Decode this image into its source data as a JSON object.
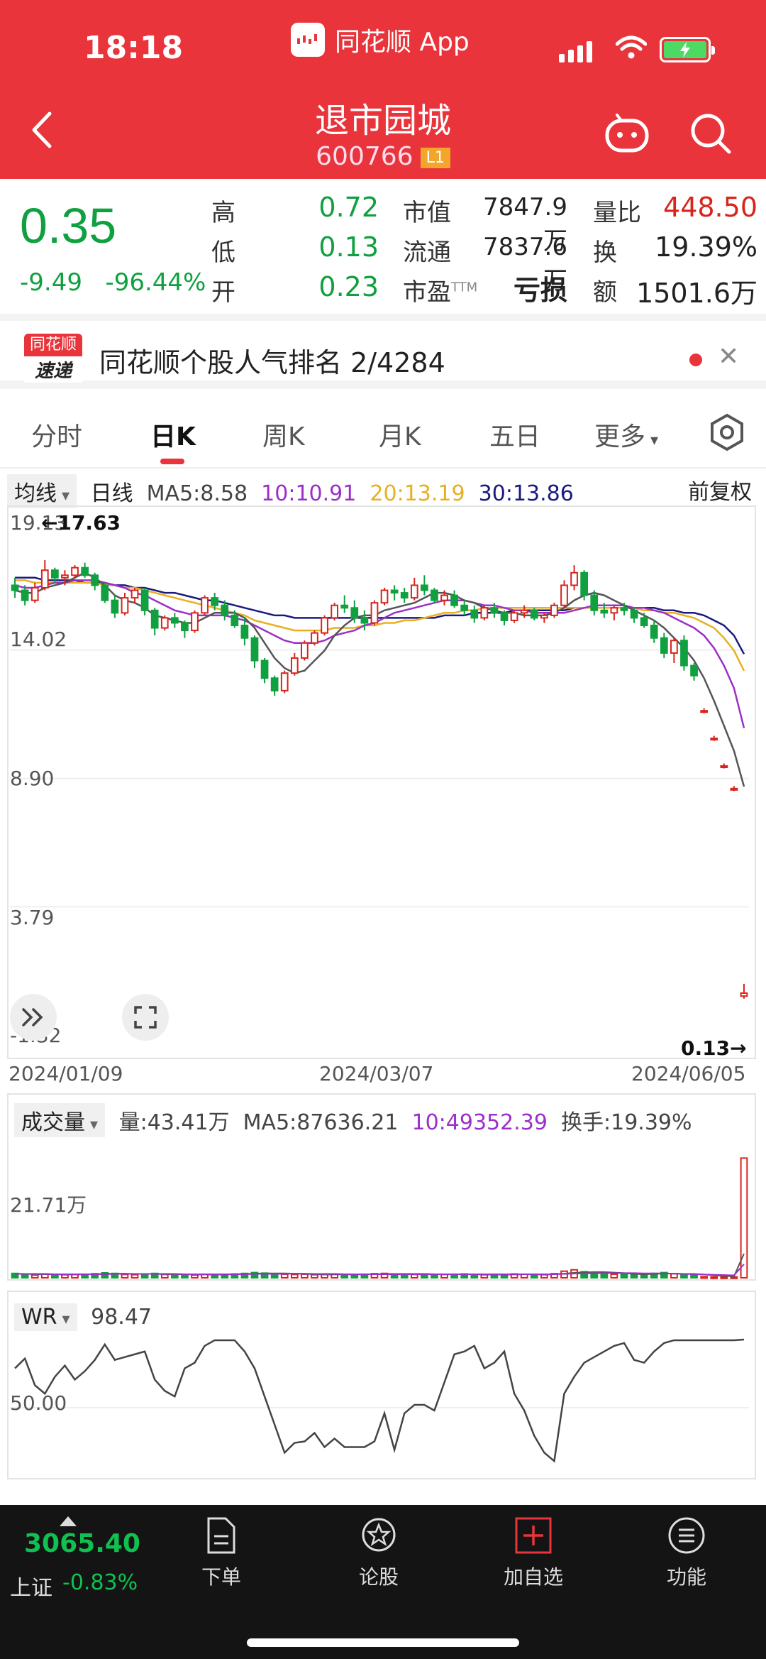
{
  "status": {
    "time": "18:18",
    "app_name": "同花顺 App"
  },
  "header": {
    "title": "退市园城",
    "code": "600766",
    "level_badge": "L1"
  },
  "quote": {
    "price": "0.35",
    "change": "-9.49",
    "change_pct": "-96.44%",
    "high_label": "高",
    "high": "0.72",
    "low_label": "低",
    "low": "0.13",
    "open_label": "开",
    "open": "0.23",
    "mcap_label": "市值",
    "mcap": "7847.9万",
    "float_label": "流通",
    "float": "7837.6万",
    "pe_label": "市盈",
    "pe_sup": "TTM",
    "pe": "亏损",
    "vr_label": "量比",
    "vr": "448.50",
    "turnover_label": "换",
    "turnover": "19.39%",
    "amount_label": "额",
    "amount": "1501.6万"
  },
  "popularity": {
    "logo_top": "同花顺",
    "logo_bottom": "速递",
    "text": "同花顺个股人气排名 2/4284"
  },
  "tabs": [
    "分时",
    "日K",
    "周K",
    "月K",
    "五日",
    "更多"
  ],
  "kline": {
    "ma_dropdown": "均线",
    "period": "日线",
    "ma5": "MA5:8.58",
    "ma10": "10:10.91",
    "ma20": "20:13.19",
    "ma30": "30:13.86",
    "adjust": "前复权",
    "yticks": [
      "19.13",
      "14.02",
      "8.90",
      "3.79",
      "-1.32"
    ],
    "max_label": "←17.63",
    "min_label": "0.13→",
    "dates": [
      "2024/01/09",
      "2024/03/07",
      "2024/06/05"
    ]
  },
  "volume": {
    "dropdown": "成交量",
    "vol": "量:43.41万",
    "ma5": "MA5:87636.21",
    "ma10": "10:49352.39",
    "turnover": "换手:19.39%",
    "ytick": "21.71万"
  },
  "wr": {
    "dropdown": "WR",
    "value": "98.47",
    "ytick": "50.00"
  },
  "bottom": {
    "index_value": "3065.40",
    "index_name": "上证",
    "index_change": "-0.83%",
    "nav": [
      "下单",
      "论股",
      "加自选",
      "功能"
    ]
  },
  "colors": {
    "up": "#d8241c",
    "down": "#10a040",
    "ma5": "#555555",
    "ma10": "#9b30c8",
    "ma20": "#e8b020",
    "ma30": "#1a1a80",
    "brand": "#e8343a"
  },
  "chart_data": [
    {
      "type": "candlestick",
      "title": "日线",
      "x_range": [
        "2024/01/09",
        "2024/06/05"
      ],
      "ylim": [
        -1.32,
        19.13
      ],
      "ohlc": [
        [
          16.6,
          16.9,
          16.1,
          16.4
        ],
        [
          16.4,
          16.6,
          15.8,
          16.0
        ],
        [
          16.0,
          16.7,
          15.9,
          16.5
        ],
        [
          16.5,
          17.6,
          16.4,
          17.2
        ],
        [
          17.2,
          17.3,
          16.7,
          16.9
        ],
        [
          16.9,
          17.2,
          16.6,
          17.0
        ],
        [
          17.0,
          17.4,
          16.9,
          17.3
        ],
        [
          17.3,
          17.5,
          16.9,
          17.0
        ],
        [
          17.0,
          17.1,
          16.4,
          16.6
        ],
        [
          16.6,
          16.7,
          15.9,
          16.0
        ],
        [
          16.0,
          16.2,
          15.3,
          15.5
        ],
        [
          15.5,
          16.3,
          15.4,
          16.1
        ],
        [
          16.1,
          16.5,
          15.9,
          16.4
        ],
        [
          16.4,
          16.5,
          15.4,
          15.6
        ],
        [
          15.6,
          15.7,
          14.6,
          14.9
        ],
        [
          14.9,
          15.4,
          14.8,
          15.3
        ],
        [
          15.3,
          15.5,
          14.9,
          15.1
        ],
        [
          15.1,
          15.2,
          14.5,
          14.8
        ],
        [
          14.8,
          15.6,
          14.7,
          15.5
        ],
        [
          15.5,
          16.2,
          15.4,
          16.1
        ],
        [
          16.1,
          16.3,
          15.6,
          15.8
        ],
        [
          15.8,
          16.0,
          15.2,
          15.4
        ],
        [
          15.4,
          15.6,
          14.9,
          15.0
        ],
        [
          15.0,
          15.3,
          14.2,
          14.5
        ],
        [
          14.5,
          14.6,
          13.3,
          13.6
        ],
        [
          13.6,
          13.7,
          12.7,
          12.9
        ],
        [
          12.9,
          13.0,
          12.2,
          12.4
        ],
        [
          12.4,
          13.2,
          12.3,
          13.1
        ],
        [
          13.1,
          13.9,
          13.0,
          13.7
        ],
        [
          13.7,
          14.4,
          13.6,
          14.3
        ],
        [
          14.3,
          14.8,
          14.2,
          14.7
        ],
        [
          14.7,
          15.4,
          14.6,
          15.3
        ],
        [
          15.3,
          15.9,
          15.2,
          15.8
        ],
        [
          15.8,
          16.2,
          15.5,
          15.7
        ],
        [
          15.7,
          16.0,
          15.1,
          15.3
        ],
        [
          15.3,
          15.6,
          14.8,
          15.1
        ],
        [
          15.1,
          16.0,
          15.0,
          15.9
        ],
        [
          15.9,
          16.5,
          15.8,
          16.4
        ],
        [
          16.4,
          16.6,
          16.0,
          16.3
        ],
        [
          16.3,
          16.5,
          15.9,
          16.1
        ],
        [
          16.1,
          16.9,
          16.0,
          16.6
        ],
        [
          16.6,
          17.0,
          16.2,
          16.4
        ],
        [
          16.4,
          16.5,
          15.9,
          16.0
        ],
        [
          16.0,
          16.4,
          15.8,
          16.2
        ],
        [
          16.2,
          16.4,
          15.7,
          15.8
        ],
        [
          15.8,
          16.0,
          15.4,
          15.6
        ],
        [
          15.6,
          15.8,
          15.1,
          15.3
        ],
        [
          15.3,
          15.8,
          15.2,
          15.7
        ],
        [
          15.7,
          15.9,
          15.3,
          15.5
        ],
        [
          15.5,
          15.6,
          15.0,
          15.2
        ],
        [
          15.2,
          15.6,
          15.1,
          15.5
        ],
        [
          15.5,
          15.8,
          15.3,
          15.6
        ],
        [
          15.6,
          15.7,
          15.2,
          15.3
        ],
        [
          15.3,
          15.5,
          15.1,
          15.4
        ],
        [
          15.4,
          15.9,
          15.3,
          15.8
        ],
        [
          15.8,
          16.8,
          15.7,
          16.6
        ],
        [
          16.6,
          17.4,
          16.4,
          17.1
        ],
        [
          17.1,
          17.2,
          16.0,
          16.2
        ],
        [
          16.2,
          16.4,
          15.4,
          15.6
        ],
        [
          15.6,
          15.9,
          15.3,
          15.5
        ],
        [
          15.5,
          15.8,
          15.2,
          15.7
        ],
        [
          15.7,
          15.9,
          15.4,
          15.6
        ],
        [
          15.6,
          15.7,
          15.1,
          15.3
        ],
        [
          15.3,
          15.5,
          14.9,
          15.0
        ],
        [
          15.0,
          15.2,
          14.3,
          14.5
        ],
        [
          14.5,
          14.7,
          13.7,
          13.9
        ],
        [
          13.9,
          14.5,
          13.5,
          14.4
        ],
        [
          14.4,
          14.6,
          13.2,
          13.4
        ],
        [
          13.4,
          13.5,
          12.8,
          13.0
        ],
        [
          11.6,
          11.7,
          11.5,
          11.6
        ],
        [
          10.5,
          10.6,
          10.4,
          10.5
        ],
        [
          9.4,
          9.5,
          9.3,
          9.4
        ],
        [
          8.5,
          8.6,
          8.4,
          8.5
        ],
        [
          0.23,
          0.72,
          0.13,
          0.35
        ]
      ],
      "ma5": [
        16.4,
        16.3,
        16.3,
        16.5,
        16.6,
        16.7,
        16.9,
        17.1,
        16.9,
        16.6,
        16.2,
        16.0,
        15.9,
        15.7,
        15.4,
        15.3,
        15.2,
        15.1,
        15.1,
        15.3,
        15.5,
        15.5,
        15.5,
        15.3,
        14.9,
        14.3,
        13.7,
        13.3,
        13.1,
        13.2,
        13.6,
        14.0,
        14.6,
        15.0,
        15.3,
        15.4,
        15.4,
        15.6,
        15.7,
        15.8,
        15.9,
        16.1,
        16.3,
        16.3,
        16.2,
        16.0,
        15.9,
        15.7,
        15.6,
        15.5,
        15.5,
        15.4,
        15.4,
        15.4,
        15.5,
        15.7,
        16.0,
        16.2,
        16.3,
        16.2,
        16.0,
        15.8,
        15.6,
        15.4,
        15.2,
        14.9,
        14.5,
        14.1,
        13.6,
        12.9,
        12.0,
        11.0,
        10.0,
        8.58
      ],
      "ma10": [
        16.6,
        16.5,
        16.5,
        16.6,
        16.7,
        16.7,
        16.8,
        16.8,
        16.8,
        16.7,
        16.6,
        16.5,
        16.3,
        16.2,
        16.0,
        15.8,
        15.6,
        15.5,
        15.4,
        15.4,
        15.4,
        15.4,
        15.3,
        15.2,
        15.0,
        14.8,
        14.6,
        14.4,
        14.3,
        14.3,
        14.3,
        14.4,
        14.6,
        14.7,
        14.8,
        15.0,
        15.1,
        15.3,
        15.5,
        15.6,
        15.7,
        15.8,
        15.9,
        16.0,
        16.0,
        16.0,
        15.9,
        15.8,
        15.8,
        15.7,
        15.6,
        15.6,
        15.5,
        15.5,
        15.5,
        15.5,
        15.6,
        15.7,
        15.8,
        15.8,
        15.8,
        15.8,
        15.7,
        15.7,
        15.6,
        15.5,
        15.3,
        15.1,
        14.9,
        14.6,
        14.1,
        13.4,
        12.5,
        10.91
      ],
      "ma20": [
        16.8,
        16.8,
        16.7,
        16.7,
        16.7,
        16.7,
        16.7,
        16.7,
        16.7,
        16.6,
        16.6,
        16.5,
        16.5,
        16.4,
        16.3,
        16.2,
        16.1,
        16.0,
        15.9,
        15.8,
        15.7,
        15.6,
        15.5,
        15.4,
        15.2,
        15.1,
        15.0,
        14.9,
        14.8,
        14.8,
        14.8,
        14.8,
        14.9,
        14.9,
        14.9,
        15.0,
        15.0,
        15.1,
        15.1,
        15.2,
        15.2,
        15.3,
        15.4,
        15.5,
        15.5,
        15.6,
        15.6,
        15.7,
        15.7,
        15.7,
        15.7,
        15.7,
        15.7,
        15.7,
        15.7,
        15.7,
        15.7,
        15.7,
        15.7,
        15.7,
        15.7,
        15.7,
        15.7,
        15.6,
        15.6,
        15.5,
        15.5,
        15.4,
        15.3,
        15.1,
        14.9,
        14.5,
        14.0,
        13.19
      ],
      "ma30": [
        16.9,
        16.9,
        16.9,
        16.8,
        16.8,
        16.8,
        16.8,
        16.7,
        16.7,
        16.7,
        16.6,
        16.6,
        16.5,
        16.5,
        16.4,
        16.3,
        16.3,
        16.2,
        16.1,
        16.0,
        16.0,
        15.9,
        15.8,
        15.7,
        15.6,
        15.5,
        15.4,
        15.4,
        15.3,
        15.3,
        15.3,
        15.3,
        15.3,
        15.3,
        15.3,
        15.3,
        15.3,
        15.3,
        15.3,
        15.3,
        15.3,
        15.3,
        15.3,
        15.4,
        15.4,
        15.4,
        15.5,
        15.5,
        15.5,
        15.5,
        15.6,
        15.6,
        15.6,
        15.6,
        15.6,
        15.6,
        15.7,
        15.7,
        15.7,
        15.7,
        15.7,
        15.7,
        15.7,
        15.7,
        15.7,
        15.6,
        15.6,
        15.5,
        15.5,
        15.4,
        15.2,
        15.0,
        14.6,
        13.86
      ]
    },
    {
      "type": "bar",
      "title": "成交量",
      "unit": "万",
      "ylim": [
        0,
        52
      ],
      "values": [
        1.6,
        1.2,
        1.0,
        1.4,
        1.3,
        1.1,
        1.2,
        1.3,
        1.5,
        1.8,
        1.6,
        1.2,
        1.1,
        1.3,
        1.6,
        1.2,
        1.1,
        1.2,
        1.0,
        1.3,
        1.2,
        1.3,
        1.4,
        1.6,
        1.9,
        1.7,
        1.5,
        1.3,
        1.2,
        1.3,
        1.1,
        1.2,
        1.4,
        1.3,
        1.2,
        1.3,
        1.5,
        1.6,
        1.4,
        1.3,
        1.2,
        1.4,
        1.3,
        1.2,
        1.3,
        1.4,
        1.2,
        1.1,
        1.3,
        1.2,
        1.4,
        1.3,
        1.2,
        1.1,
        1.5,
        2.4,
        2.9,
        2.2,
        1.6,
        1.4,
        1.3,
        1.2,
        1.3,
        1.4,
        1.6,
        1.9,
        1.5,
        1.3,
        1.1,
        0.4,
        0.3,
        0.3,
        0.3,
        43.41
      ],
      "ma5": [
        1.4,
        1.4,
        1.3,
        1.3,
        1.3,
        1.2,
        1.2,
        1.3,
        1.3,
        1.4,
        1.5,
        1.5,
        1.4,
        1.4,
        1.4,
        1.3,
        1.3,
        1.3,
        1.2,
        1.2,
        1.2,
        1.2,
        1.3,
        1.4,
        1.5,
        1.6,
        1.6,
        1.6,
        1.5,
        1.4,
        1.3,
        1.2,
        1.2,
        1.3,
        1.2,
        1.3,
        1.3,
        1.4,
        1.4,
        1.4,
        1.4,
        1.4,
        1.3,
        1.3,
        1.3,
        1.3,
        1.3,
        1.2,
        1.2,
        1.2,
        1.2,
        1.3,
        1.3,
        1.2,
        1.3,
        1.5,
        1.8,
        2.0,
        2.1,
        2.1,
        1.9,
        1.7,
        1.4,
        1.3,
        1.4,
        1.5,
        1.5,
        1.4,
        1.4,
        1.2,
        0.9,
        0.7,
        0.5,
        8.76
      ],
      "ma10": [
        1.5,
        1.4,
        1.4,
        1.4,
        1.3,
        1.3,
        1.3,
        1.3,
        1.3,
        1.3,
        1.4,
        1.4,
        1.4,
        1.4,
        1.4,
        1.4,
        1.4,
        1.3,
        1.3,
        1.3,
        1.3,
        1.3,
        1.3,
        1.3,
        1.4,
        1.4,
        1.4,
        1.4,
        1.5,
        1.5,
        1.4,
        1.4,
        1.4,
        1.3,
        1.3,
        1.3,
        1.3,
        1.3,
        1.3,
        1.3,
        1.3,
        1.3,
        1.3,
        1.3,
        1.3,
        1.3,
        1.3,
        1.3,
        1.3,
        1.3,
        1.3,
        1.3,
        1.3,
        1.3,
        1.3,
        1.4,
        1.5,
        1.6,
        1.6,
        1.7,
        1.7,
        1.7,
        1.7,
        1.6,
        1.6,
        1.6,
        1.5,
        1.4,
        1.3,
        1.2,
        1.1,
        1.0,
        0.9,
        4.94
      ]
    },
    {
      "type": "line",
      "title": "WR",
      "ylim": [
        0,
        100
      ],
      "values": [
        78,
        85,
        66,
        60,
        72,
        80,
        70,
        76,
        84,
        95,
        84,
        86,
        88,
        90,
        70,
        62,
        58,
        78,
        82,
        94,
        98,
        98,
        98,
        90,
        78,
        58,
        38,
        18,
        25,
        26,
        32,
        22,
        28,
        22,
        22,
        22,
        26,
        46,
        20,
        46,
        52,
        52,
        48,
        68,
        88,
        90,
        94,
        78,
        82,
        90,
        60,
        48,
        30,
        18,
        12,
        60,
        72,
        82,
        86,
        90,
        94,
        96,
        84,
        82,
        90,
        96,
        98,
        98,
        98,
        98,
        98,
        98,
        98,
        98.47
      ]
    }
  ]
}
